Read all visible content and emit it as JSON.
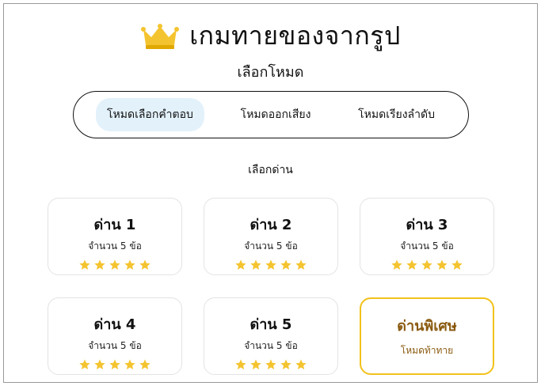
{
  "header": {
    "title": "เกมทายของจากรูป",
    "crown_color": "#f4c430"
  },
  "mode_section": {
    "label": "เลือกโหมด",
    "tabs": [
      {
        "label": "โหมดเลือกคำตอบ",
        "active": true
      },
      {
        "label": "โหมดออกเสียง",
        "active": false
      },
      {
        "label": "โหมดเรียงลำดับ",
        "active": false
      }
    ]
  },
  "level_section": {
    "label": "เลือกด่าน",
    "levels": [
      {
        "name": "ด่าน 1",
        "count": "จำนวน 5 ข้อ",
        "stars": 5
      },
      {
        "name": "ด่าน 2",
        "count": "จำนวน 5 ข้อ",
        "stars": 5
      },
      {
        "name": "ด่าน 3",
        "count": "จำนวน 5 ข้อ",
        "stars": 5
      },
      {
        "name": "ด่าน 4",
        "count": "จำนวน 5 ข้อ",
        "stars": 5
      },
      {
        "name": "ด่าน 5",
        "count": "จำนวน 5 ข้อ",
        "stars": 5
      }
    ],
    "special": {
      "name": "ด่านพิเศษ",
      "subtitle": "โหมดท้าทาย"
    }
  },
  "colors": {
    "star": "#f4c430",
    "active_tab_bg": "#e3f1fb",
    "special_border": "#f2c21b",
    "special_text": "#8a5a10"
  }
}
